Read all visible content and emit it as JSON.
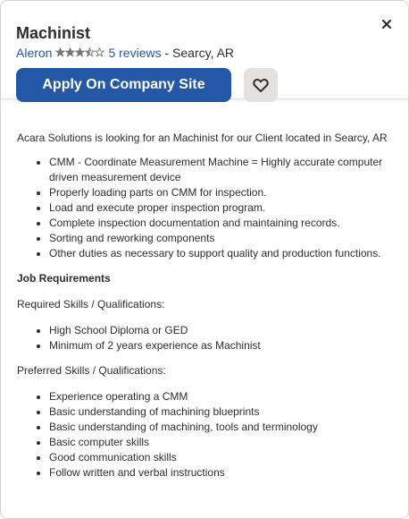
{
  "header": {
    "job_title": "Machinist",
    "company": "Aleron",
    "rating": 3.5,
    "reviews_label": "5 reviews",
    "location_text": "- Searcy, AR",
    "apply_label": "Apply On Company Site",
    "colors": {
      "accent": "#2557a7",
      "save_bg": "#e4e2e0",
      "star": "#767676"
    }
  },
  "icons": {
    "close": "close-icon",
    "save": "heart-icon",
    "rating": "star-icon"
  },
  "description": {
    "intro": "Acara Solutions is looking for an Machinist for our Client located in Searcy, AR",
    "duties": [
      "CMM - Coordinate Measurement Machine = Highly accurate computer driven measurement device",
      "Properly loading parts on CMM for inspection.",
      "Load and execute proper inspection program.",
      "Complete inspection documentation and maintaining records.",
      "Sorting and reworking components",
      "Other duties as necessary to support quality and production functions."
    ],
    "requirements_heading": "Job Requirements",
    "required_heading": "Required Skills / Qualifications:",
    "required": [
      "High School Diploma or GED",
      "Minimum of 2 years experience as Machinist"
    ],
    "preferred_heading": "Preferred Skills / Qualifications:",
    "preferred": [
      "Experience operating a CMM",
      "Basic understanding of machining blueprints",
      "Basic understanding of machining, tools and terminology",
      "Basic computer skills",
      "Good communication skills",
      "Follow written and verbal instructions"
    ]
  }
}
